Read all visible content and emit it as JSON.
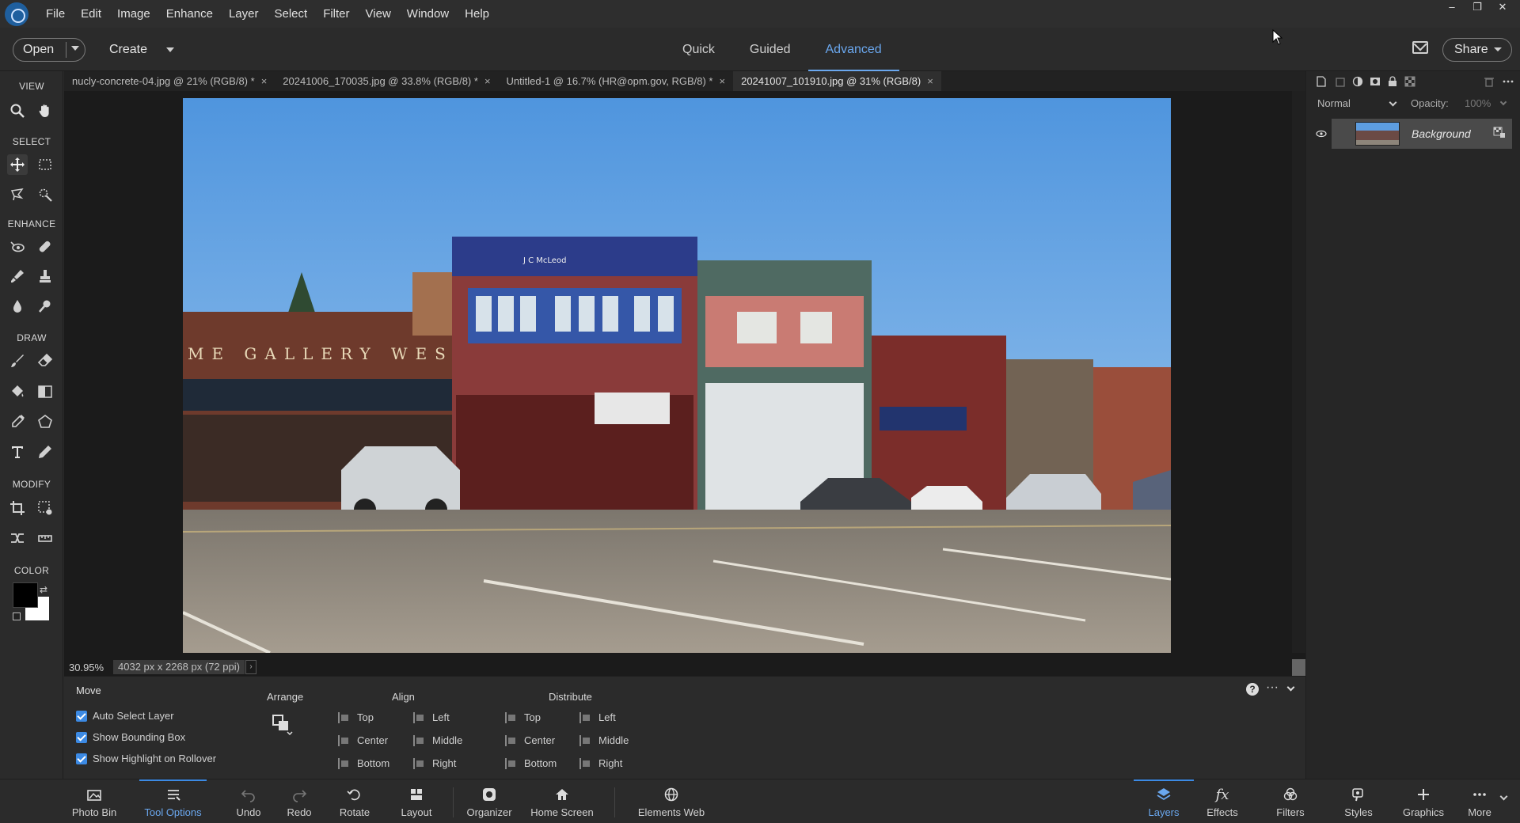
{
  "menubar": {
    "items": [
      "File",
      "Edit",
      "Image",
      "Enhance",
      "Layer",
      "Select",
      "Filter",
      "View",
      "Window",
      "Help"
    ]
  },
  "window_controls": {
    "minimize": "–",
    "restore": "❐",
    "close": "✕"
  },
  "modebar": {
    "open_label": "Open",
    "create_label": "Create",
    "tabs": [
      "Quick",
      "Guided",
      "Advanced"
    ],
    "active_tab": "Advanced",
    "share_label": "Share"
  },
  "toolbox": {
    "sections": [
      "VIEW",
      "SELECT",
      "ENHANCE",
      "DRAW",
      "MODIFY",
      "COLOR"
    ],
    "foreground_color": "#000000",
    "background_color": "#ffffff"
  },
  "doc_tabs": [
    {
      "label": "nucly-concrete-04.jpg @ 21% (RGB/8) *",
      "close": "×"
    },
    {
      "label": "20241006_170035.jpg @ 33.8% (RGB/8) *",
      "close": "×"
    },
    {
      "label": "Untitled-1 @ 16.7% (HR@opm.gov, RGB/8) *",
      "close": "×"
    },
    {
      "label": "20241007_101910.jpg @ 31% (RGB/8)",
      "close": "×"
    }
  ],
  "canvas": {
    "sign_text": "ME GALLERY WEST",
    "building_sign": "J C McLeod"
  },
  "status": {
    "zoom": "30.95%",
    "doc_size": "4032 px x 2268 px (72 ppi)",
    "arrow": "›"
  },
  "layers_panel": {
    "blend_mode": "Normal",
    "opacity_label": "Opacity:",
    "opacity_value": "100%",
    "layer_name": "Background"
  },
  "tool_options": {
    "title": "Move",
    "checkboxes": [
      "Auto Select Layer",
      "Show Bounding Box",
      "Show Highlight on Rollover"
    ],
    "arrange_label": "Arrange",
    "align_label": "Align",
    "align_col1": [
      "Top",
      "Center",
      "Bottom"
    ],
    "align_col2": [
      "Left",
      "Middle",
      "Right"
    ],
    "distribute_label": "Distribute",
    "distribute_col1": [
      "Top",
      "Center",
      "Bottom"
    ],
    "distribute_col2": [
      "Left",
      "Middle",
      "Right"
    ],
    "help": "?",
    "more": "···"
  },
  "taskbar": {
    "left": [
      "Photo Bin",
      "Tool Options",
      "Undo",
      "Redo",
      "Rotate",
      "Layout",
      "Organizer",
      "Home Screen",
      "Elements Web"
    ],
    "right": [
      "Layers",
      "Effects",
      "Filters",
      "Styles",
      "Graphics",
      "More"
    ],
    "active_left": "Tool Options",
    "active_right": "Layers"
  },
  "colors": {
    "accent": "#6aa7ee",
    "checkbox": "#3c8ae4"
  }
}
